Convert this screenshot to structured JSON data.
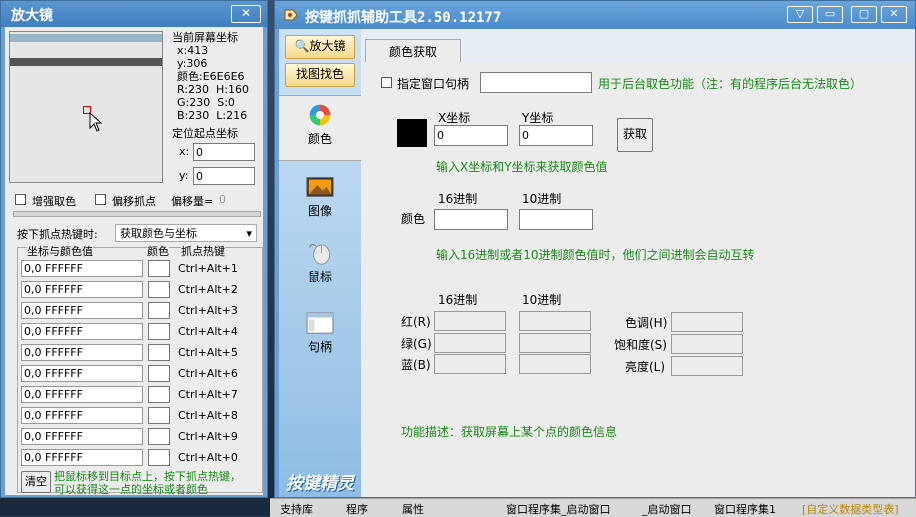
{
  "magnifier": {
    "title": "放大镜",
    "close_label": "✕",
    "screen_coord_label": "当前屏幕坐标",
    "x_info": "x:413",
    "y_info": "y:306",
    "color_info": "颜色:E6E6E6",
    "rh_info": "R:230  H:160",
    "gs_info": "G:230  S:0",
    "bl_info": "B:230  L:216",
    "origin_label": "定位起点坐标",
    "origin_x_label": "x:",
    "origin_x_value": "0",
    "origin_y_label": "y:",
    "origin_y_value": "0",
    "enhance_label": "增强取色",
    "offset_label": "偏移抓点",
    "offset_amount_label": "偏移量=",
    "offset_amount_value": "0",
    "hotkey_label": "按下抓点热键时:",
    "hotkey_select": "获取颜色与坐标",
    "col_coord": "坐标与颜色值",
    "col_color": "颜色",
    "col_hotkey": "抓点热键",
    "rows": [
      {
        "value": "0,0  FFFFFF",
        "hotkey": "Ctrl+Alt+1"
      },
      {
        "value": "0,0  FFFFFF",
        "hotkey": "Ctrl+Alt+2"
      },
      {
        "value": "0,0  FFFFFF",
        "hotkey": "Ctrl+Alt+3"
      },
      {
        "value": "0,0  FFFFFF",
        "hotkey": "Ctrl+Alt+4"
      },
      {
        "value": "0,0  FFFFFF",
        "hotkey": "Ctrl+Alt+5"
      },
      {
        "value": "0,0  FFFFFF",
        "hotkey": "Ctrl+Alt+6"
      },
      {
        "value": "0,0  FFFFFF",
        "hotkey": "Ctrl+Alt+7"
      },
      {
        "value": "0,0  FFFFFF",
        "hotkey": "Ctrl+Alt+8"
      },
      {
        "value": "0,0  FFFFFF",
        "hotkey": "Ctrl+Alt+9"
      },
      {
        "value": "0,0  FFFFFF",
        "hotkey": "Ctrl+Alt+0"
      }
    ],
    "clear_label": "清空",
    "hint_line1": "把鼠标移到目标点上，按下抓点热键，",
    "hint_line2": "可以获得这一点的坐标或者颜色"
  },
  "main": {
    "title": "按键抓抓辅助工具2.50.12177",
    "btn_minimize_alt": "▽",
    "btn_minimize": "▭",
    "btn_maximize": "▢",
    "btn_close": "✕",
    "sidebar": {
      "magnifier_btn": "放大镜",
      "findimg_btn": "找图找色",
      "nav_color": "颜色",
      "nav_image": "图像",
      "nav_mouse": "鼠标",
      "nav_handle": "句柄",
      "brand": "按键精灵"
    },
    "tab": "颜色获取",
    "specify_window_label": "指定窗口句柄",
    "specify_window_value": "",
    "specify_hint": "用于后台取色功能（注：有的程序后台无法取色）",
    "x_label": "X坐标",
    "y_label": "Y坐标",
    "x_value": "0",
    "y_value": "0",
    "get_btn": "获取",
    "xy_hint": "输入X坐标和Y坐标来获取颜色值",
    "hex_label": "16进制",
    "dec_label": "10进制",
    "color_label": "颜色",
    "convert_hint": "输入16进制或者10进制颜色值时，他们之间进制会自动互转",
    "hex_label2": "16进制",
    "dec_label2": "10进制",
    "red_label": "红(R)",
    "green_label": "绿(G)",
    "blue_label": "蓝(B)",
    "hue_label": "色调(H)",
    "sat_label": "饱和度(S)",
    "lum_label": "亮度(L)",
    "desc": "功能描述：获取屏幕上某个点的颜色信息"
  },
  "taskbar": {
    "items": [
      "支持库",
      "程序",
      "属性",
      "窗口程序集_启动窗口",
      "_启动窗口",
      "窗口程序集1",
      "[自定义数据类型表]"
    ]
  }
}
